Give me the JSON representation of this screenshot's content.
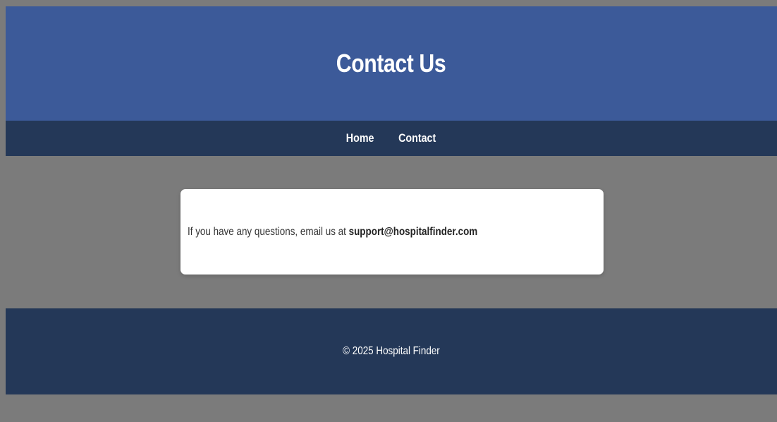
{
  "header": {
    "title": "Contact Us"
  },
  "nav": {
    "items": [
      {
        "label": "Home"
      },
      {
        "label": "Contact"
      }
    ]
  },
  "contact": {
    "text": "If you have any questions, email us at",
    "email": "support@hospitalfinder.com"
  },
  "footer": {
    "text": "© 2025 Hospital Finder"
  },
  "colors": {
    "header": "#3c5a99",
    "nav": "#243858",
    "background": "#7b7b7b",
    "card": "#ffffff",
    "footer": "#243858"
  }
}
